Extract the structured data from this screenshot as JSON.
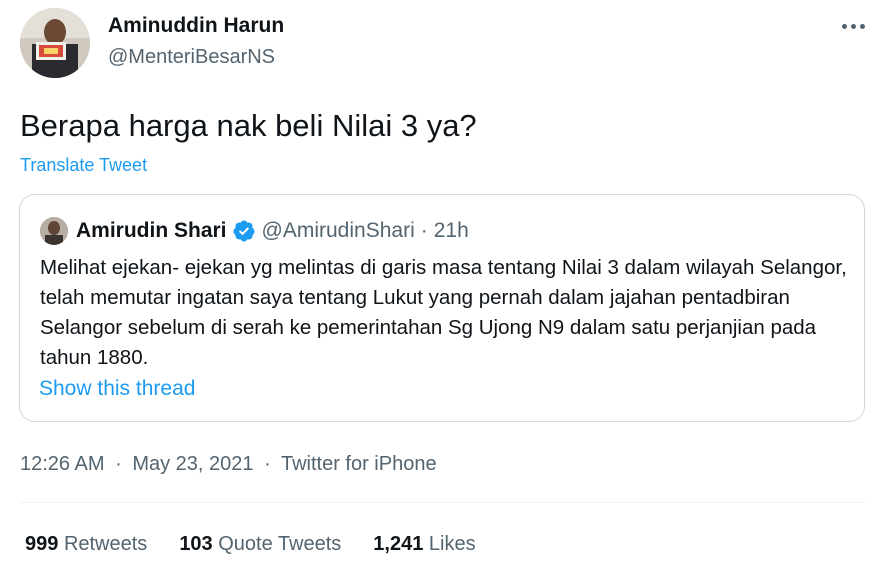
{
  "author": {
    "name": "Aminuddin Harun",
    "handle": "@MenteriBesarNS"
  },
  "tweet": {
    "text": "Berapa harga nak beli Nilai 3 ya?",
    "translate_label": "Translate Tweet"
  },
  "quoted": {
    "name": "Amirudin Shari",
    "handle": "@AmirudinShari",
    "separator": "·",
    "time": "21h",
    "text": "Melihat ejekan- ejekan yg melintas di garis masa tentang Nilai 3 dalam wilayah Selangor, telah memutar ingatan saya tentang Lukut yang pernah dalam jajahan pentadbiran Selangor sebelum di serah ke pemerintahan Sg Ujong N9 dalam satu perjanjian pada tahun 1880.",
    "show_thread_label": "Show this thread"
  },
  "meta": {
    "time": "12:26 AM",
    "date": "May 23, 2021",
    "source": "Twitter for iPhone",
    "separator": "·"
  },
  "stats": {
    "retweets_count": "999",
    "retweets_label": "Retweets",
    "quotes_count": "103",
    "quotes_label": "Quote Tweets",
    "likes_count": "1,241",
    "likes_label": "Likes"
  },
  "colors": {
    "accent": "#1d9bf0",
    "secondary_text": "#536471",
    "border": "#cfd9de"
  },
  "icons": {
    "more": "more-horizontal-icon",
    "verified": "verified-badge-icon"
  }
}
